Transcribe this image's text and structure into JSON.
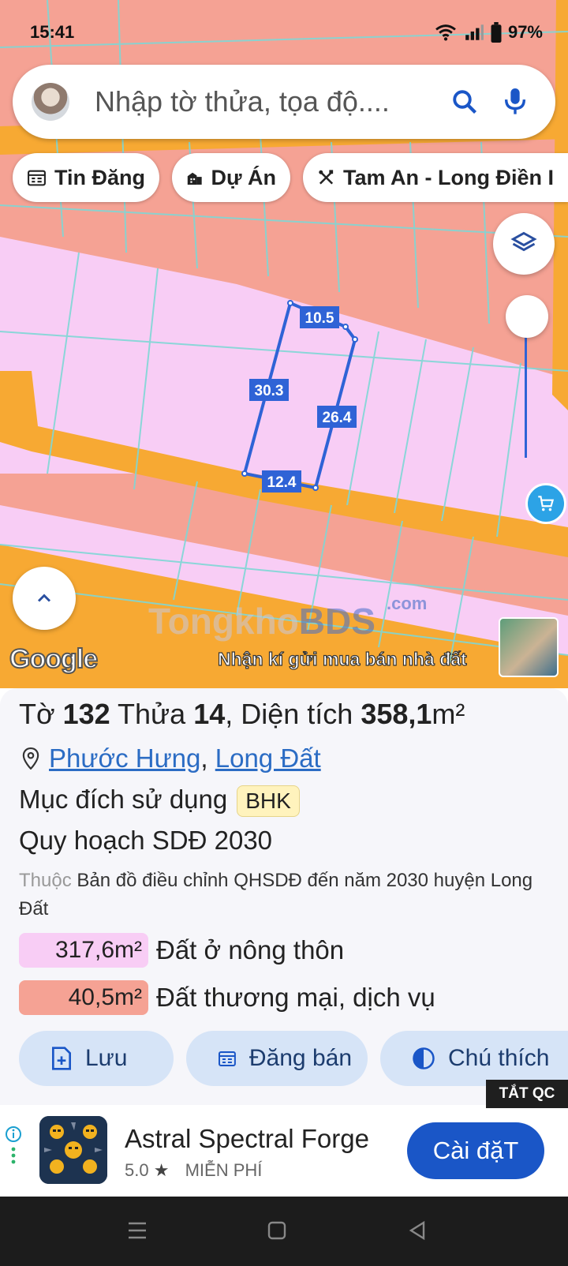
{
  "status": {
    "time": "15:41",
    "battery": "97%"
  },
  "search": {
    "placeholder": "Nhập tờ thửa, tọa độ...."
  },
  "chips": [
    {
      "label": "Tin Đăng",
      "icon": "calendar-list-icon"
    },
    {
      "label": "Dự Án",
      "icon": "buildings-icon"
    },
    {
      "label": "Tam An - Long Điền I",
      "icon": "tools-icon"
    }
  ],
  "map": {
    "edge_labels": [
      "10.5",
      "30.3",
      "26.4",
      "12.4"
    ],
    "google_label": "Google",
    "watermark": {
      "prefix": "Tongkho",
      "brand": "BDS",
      "suffix": ".com"
    },
    "promo_text": "Nhận kí gửi mua bán nhà đất",
    "colors": {
      "residential": "#f8cdf5",
      "commercial": "#f5a294",
      "road": "#f7a933",
      "parcel": "#2f63d6"
    }
  },
  "info": {
    "title_prefix": "Tờ ",
    "sheet_no": "132",
    "title_mid": " Thửa ",
    "parcel_no": "14",
    "title_area_label": ", Diện tích ",
    "area": "358,1",
    "area_unit": "m²",
    "ward": "Phước Hưng",
    "district": "Long Đất",
    "purpose_label": "Mục đích sử dụng",
    "purpose_code": "BHK",
    "plan_label": "Quy hoạch SDĐ 2030",
    "desc_muted": "Thuộc",
    "desc": "Bản đồ điều chỉnh QHSDĐ đến năm 2030 huyện Long Đất",
    "areas": [
      {
        "value": "317,6m²",
        "label": "Đất ở nông thôn",
        "color": "#f8cdf5"
      },
      {
        "value": "40,5m²",
        "label": "Đất thương mại, dịch vụ",
        "color": "#f5a294"
      }
    ]
  },
  "actions": [
    {
      "label": "Lưu",
      "icon": "file-add-icon"
    },
    {
      "label": "Đăng bán",
      "icon": "form-icon"
    },
    {
      "label": "Chú thích",
      "icon": "contrast-icon"
    }
  ],
  "ad": {
    "close_label": "TẮT QC",
    "title": "Astral Spectral Forge",
    "rating": "5.0",
    "price": "MIỄN PHÍ",
    "cta": "Cài đặT"
  }
}
